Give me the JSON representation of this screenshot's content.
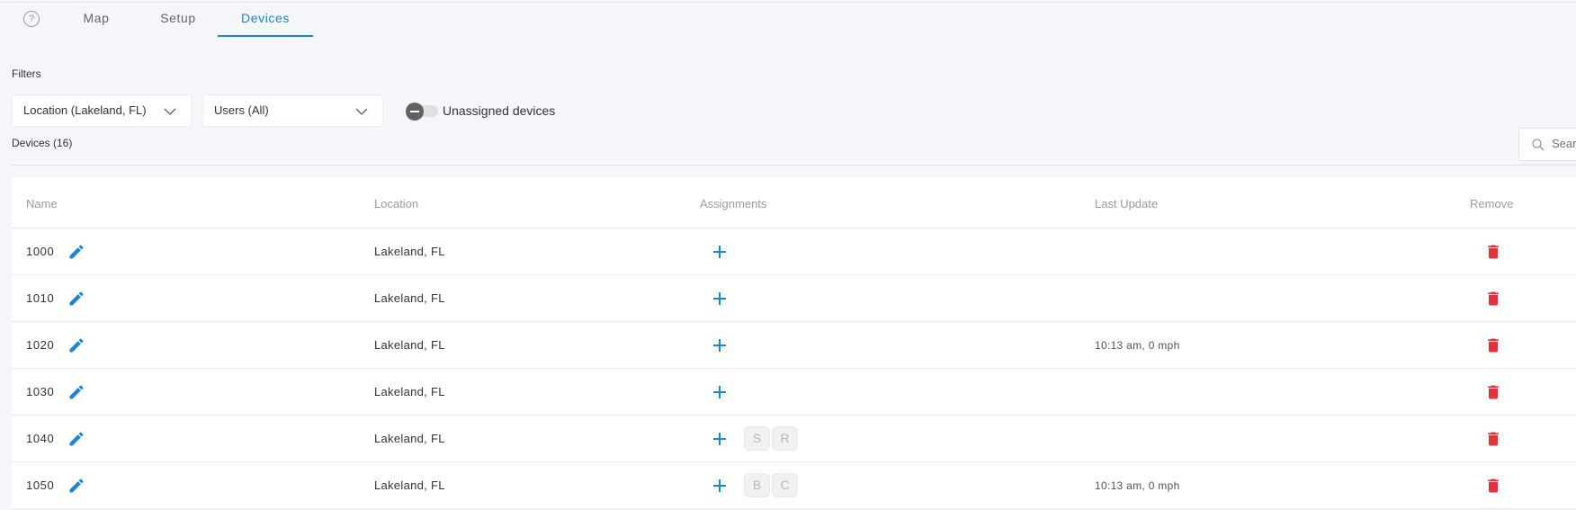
{
  "tabs": [
    {
      "label": "Map",
      "active": false
    },
    {
      "label": "Setup",
      "active": false
    },
    {
      "label": "Devices",
      "active": true
    }
  ],
  "filters": {
    "label": "Filters",
    "location_dropdown": "Location (Lakeland, FL)",
    "users_dropdown": "Users (All)",
    "unassigned_toggle_label": "Unassigned devices",
    "unassigned_toggle_on": false
  },
  "devices_count_label": "Devices (16)",
  "search": {
    "placeholder": "Search"
  },
  "colors": {
    "accent": "#1a84d6",
    "danger": "#e0333c"
  },
  "icons": [
    "help-icon",
    "chevron-down-icon",
    "search-icon",
    "edit-icon",
    "plus-icon",
    "trash-icon"
  ],
  "table": {
    "headers": {
      "name": "Name",
      "location": "Location",
      "assignments": "Assignments",
      "last_update": "Last Update",
      "remove": "Remove"
    },
    "rows": [
      {
        "name": "1000",
        "location": "Lakeland, FL",
        "assignments": [],
        "last_update": ""
      },
      {
        "name": "1010",
        "location": "Lakeland, FL",
        "assignments": [],
        "last_update": ""
      },
      {
        "name": "1020",
        "location": "Lakeland, FL",
        "assignments": [],
        "last_update": "10:13 am, 0 mph"
      },
      {
        "name": "1030",
        "location": "Lakeland, FL",
        "assignments": [],
        "last_update": ""
      },
      {
        "name": "1040",
        "location": "Lakeland, FL",
        "assignments": [
          "S",
          "R"
        ],
        "last_update": ""
      },
      {
        "name": "1050",
        "location": "Lakeland, FL",
        "assignments": [
          "B",
          "C"
        ],
        "last_update": "10:13 am, 0 mph"
      }
    ]
  }
}
